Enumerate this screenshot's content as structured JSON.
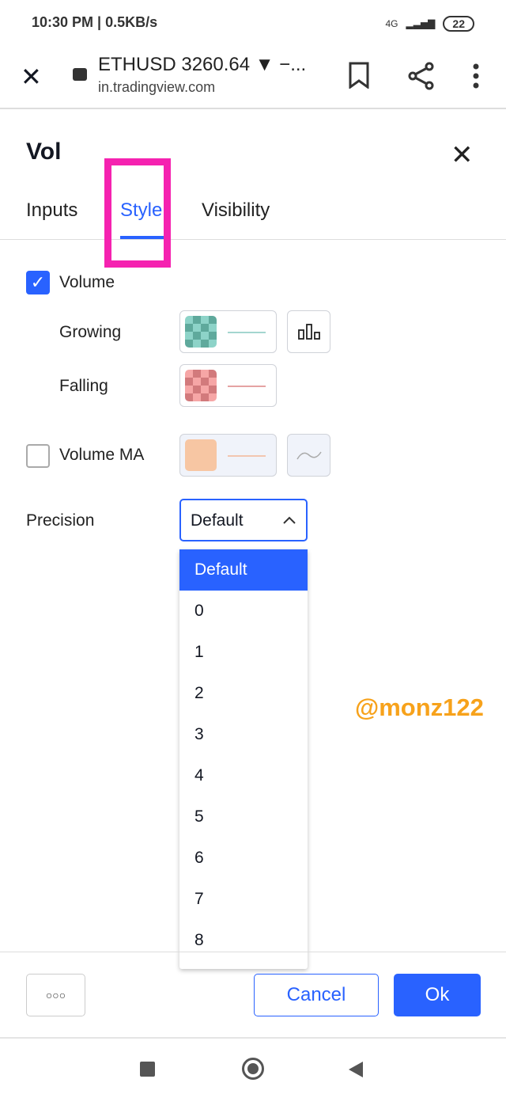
{
  "status_bar": {
    "time_info": "10:30 PM | 0.5KB/s",
    "network": "4G",
    "battery": "22"
  },
  "browser": {
    "title": "ETHUSD 3260.64 ▼ −...",
    "url": "in.tradingview.com"
  },
  "dialog": {
    "title": "Vol",
    "tabs": [
      {
        "label": "Inputs"
      },
      {
        "label": "Style",
        "active": true
      },
      {
        "label": "Visibility"
      }
    ],
    "volume": {
      "label": "Volume",
      "checked": true,
      "growing_label": "Growing",
      "falling_label": "Falling",
      "growing_color": "#26a69a",
      "falling_color": "#ef5350"
    },
    "volume_ma": {
      "label": "Volume MA",
      "checked": false,
      "color": "#f7c6a3"
    },
    "precision": {
      "label": "Precision",
      "value": "Default",
      "options": [
        "Default",
        "0",
        "1",
        "2",
        "3",
        "4",
        "5",
        "6",
        "7",
        "8"
      ]
    },
    "footer": {
      "more": "○○○",
      "cancel": "Cancel",
      "ok": "Ok"
    }
  },
  "watermark": "@monz122",
  "colors": {
    "accent": "#2962ff",
    "highlight": "#f522b0",
    "watermark": "#f7a21b"
  }
}
